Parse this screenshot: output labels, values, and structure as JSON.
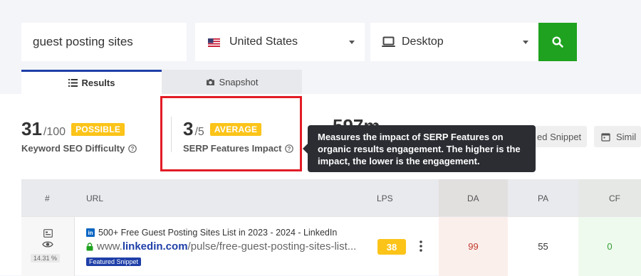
{
  "search": {
    "keyword": "guest posting sites",
    "country": "United States",
    "device": "Desktop"
  },
  "tabs": [
    {
      "label": "Results",
      "active": true
    },
    {
      "label": "Snapshot",
      "active": false
    }
  ],
  "metrics": {
    "kd": {
      "value": "31",
      "max": "/100",
      "badge": "POSSIBLE",
      "label": "Keyword SEO Difficulty"
    },
    "serp": {
      "value": "3",
      "max": "/5",
      "badge": "AVERAGE",
      "label": "SERP Features Impact"
    },
    "traffic": {
      "value": "597m"
    }
  },
  "pills": {
    "featured_snippet": "ed Snippet",
    "similar": "Simil"
  },
  "tooltip": {
    "line1_a": "Measures the ",
    "line1_b": "impact of SERP Features",
    "line1_c": " on",
    "rest": "organic results engagement. The higher is the impact, the lower is the engagement."
  },
  "table": {
    "headers": {
      "num": "#",
      "url": "URL",
      "lps": "LPS",
      "da": "DA",
      "pa": "PA",
      "cf": "CF"
    },
    "rows": [
      {
        "ctr": "14.31 %",
        "title": "500+ Free Guest Posting Sites List in 2023 - 2024 - LinkedIn",
        "url_prefix": "www.",
        "url_domain": "linkedin.com",
        "url_path": "/pulse/free-guest-posting-sites-list...",
        "feature": "Featured Snippet",
        "lps": "38",
        "da": "99",
        "pa": "55",
        "cf": "0"
      }
    ]
  },
  "colors": {
    "accent": "#1f3fa8",
    "search_button": "#1fa21f",
    "badge": "#fcc419",
    "highlight": "#e21c25",
    "tooltip_bg": "#2b2d33"
  }
}
